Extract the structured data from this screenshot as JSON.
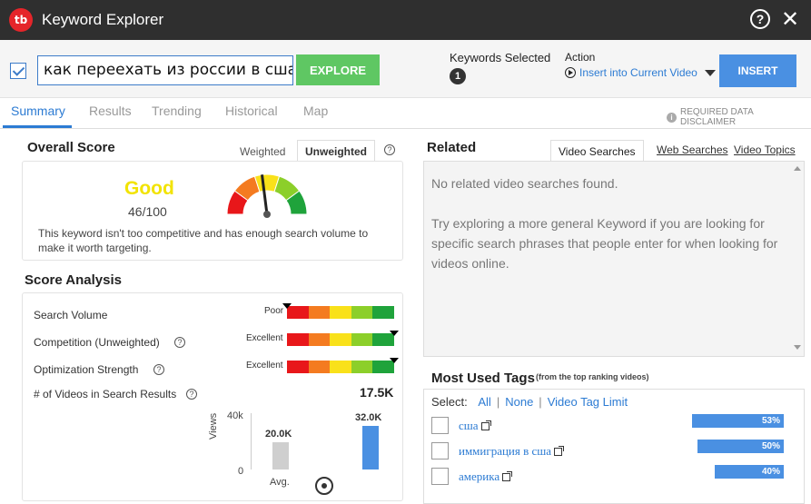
{
  "header": {
    "logo_text": "tb",
    "title": "Keyword Explorer",
    "help_symbol": "?",
    "close_symbol": "✕"
  },
  "search": {
    "keyword_value": "как переехать из россии в сша в",
    "explore_label": "EXPLORE",
    "keywords_selected_label": "Keywords Selected",
    "keywords_selected_count": "1",
    "action_label": "Action",
    "action_value": "Insert into Current Video",
    "insert_label": "INSERT"
  },
  "tabs": [
    "Summary",
    "Results",
    "Trending",
    "Historical",
    "Map"
  ],
  "disclaimer": "REQUIRED DATA DISCLAIMER",
  "overall": {
    "title": "Overall Score",
    "toggle_weighted": "Weighted",
    "toggle_unweighted": "Unweighted",
    "rating": "Good",
    "score": "46/100",
    "score_value": 46,
    "description": "This keyword isn't too competitive and has enough search volume to make it worth targeting."
  },
  "score_analysis": {
    "title": "Score Analysis",
    "rows": [
      {
        "label": "Search Volume",
        "rating": "Poor",
        "level": 0.0,
        "help": false
      },
      {
        "label": "Competition (Unweighted)",
        "rating": "Excellent",
        "level": 1.0,
        "help": true
      },
      {
        "label": "Optimization Strength",
        "rating": "Excellent",
        "level": 1.0,
        "help": true
      }
    ],
    "videos_label": "# of Videos in Search Results",
    "videos_value": "17.5K"
  },
  "views_chart": {
    "ylabel": "Views",
    "ymax_label": "40k",
    "ymin_label": "0",
    "ylim": [
      0,
      40000
    ],
    "bars": [
      {
        "label": "Avg.",
        "value": 20000,
        "value_label": "20.0K",
        "color": "#cfcfcf"
      },
      {
        "label": "",
        "value": 32000,
        "value_label": "32.0K",
        "color": "#4a90e2"
      }
    ]
  },
  "related": {
    "title": "Related",
    "tabs": [
      "Video Searches",
      "Web Searches",
      "Video Topics"
    ],
    "empty_text": "No related video searches found.",
    "hint_text": "Try exploring a more general Keyword if you are looking for specific search phrases that people enter for when looking for videos online."
  },
  "tags": {
    "title": "Most Used Tags",
    "subtitle": "(from the top ranking videos)",
    "select_label": "Select:",
    "select_all": "All",
    "select_none": "None",
    "select_limit": "Video Tag Limit",
    "items": [
      {
        "tag": "сша",
        "percent": "53%",
        "fraction": 0.53
      },
      {
        "tag": "иммиграция в сша",
        "percent": "50%",
        "fraction": 0.5
      },
      {
        "tag": "америка",
        "percent": "40%",
        "fraction": 0.4
      }
    ]
  },
  "colors": {
    "accent": "#2c7bd3",
    "explore": "#5fc763",
    "insert": "#4a90e2",
    "good": "#f2e300",
    "scale": [
      "#e8171a",
      "#f47b20",
      "#f9e11a",
      "#8ccf2a",
      "#1fa33b"
    ]
  }
}
